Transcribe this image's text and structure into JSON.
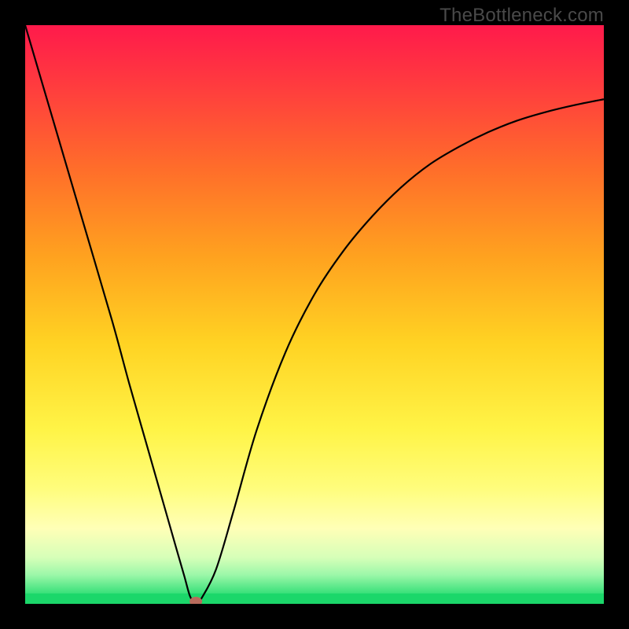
{
  "watermark": "TheBottleneck.com",
  "chart_data": {
    "type": "line",
    "title": "",
    "xlabel": "",
    "ylabel": "",
    "xlim": [
      0,
      1
    ],
    "ylim": [
      0,
      1
    ],
    "background_gradient": {
      "stops": [
        {
          "t": 0.0,
          "color": "#ff1a4b"
        },
        {
          "t": 0.1,
          "color": "#ff3a3f"
        },
        {
          "t": 0.25,
          "color": "#ff6e2a"
        },
        {
          "t": 0.4,
          "color": "#ffa21f"
        },
        {
          "t": 0.55,
          "color": "#ffd323"
        },
        {
          "t": 0.7,
          "color": "#fff447"
        },
        {
          "t": 0.8,
          "color": "#fffd7c"
        },
        {
          "t": 0.87,
          "color": "#ffffb7"
        },
        {
          "t": 0.92,
          "color": "#d6ffb8"
        },
        {
          "t": 0.95,
          "color": "#9cf7a9"
        },
        {
          "t": 0.98,
          "color": "#3fe27d"
        },
        {
          "t": 1.0,
          "color": "#1bd76a"
        }
      ]
    },
    "series": [
      {
        "name": "curve",
        "color": "#000000",
        "x": [
          0.0,
          0.05,
          0.1,
          0.15,
          0.18,
          0.21,
          0.24,
          0.26,
          0.275,
          0.285,
          0.295,
          0.305,
          0.33,
          0.36,
          0.4,
          0.45,
          0.5,
          0.55,
          0.6,
          0.65,
          0.7,
          0.75,
          0.8,
          0.85,
          0.9,
          0.95,
          1.0
        ],
        "y": [
          1.0,
          0.83,
          0.66,
          0.49,
          0.38,
          0.275,
          0.17,
          0.1,
          0.048,
          0.013,
          0.0,
          0.01,
          0.06,
          0.16,
          0.3,
          0.435,
          0.535,
          0.61,
          0.67,
          0.72,
          0.76,
          0.79,
          0.815,
          0.835,
          0.85,
          0.862,
          0.872
        ]
      }
    ],
    "marker": {
      "x": 0.295,
      "y": 0.0,
      "color": "#b86b5c"
    },
    "bottom_band": {
      "y_from": 0.0,
      "y_to": 0.018,
      "color": "#1bd76a"
    }
  }
}
